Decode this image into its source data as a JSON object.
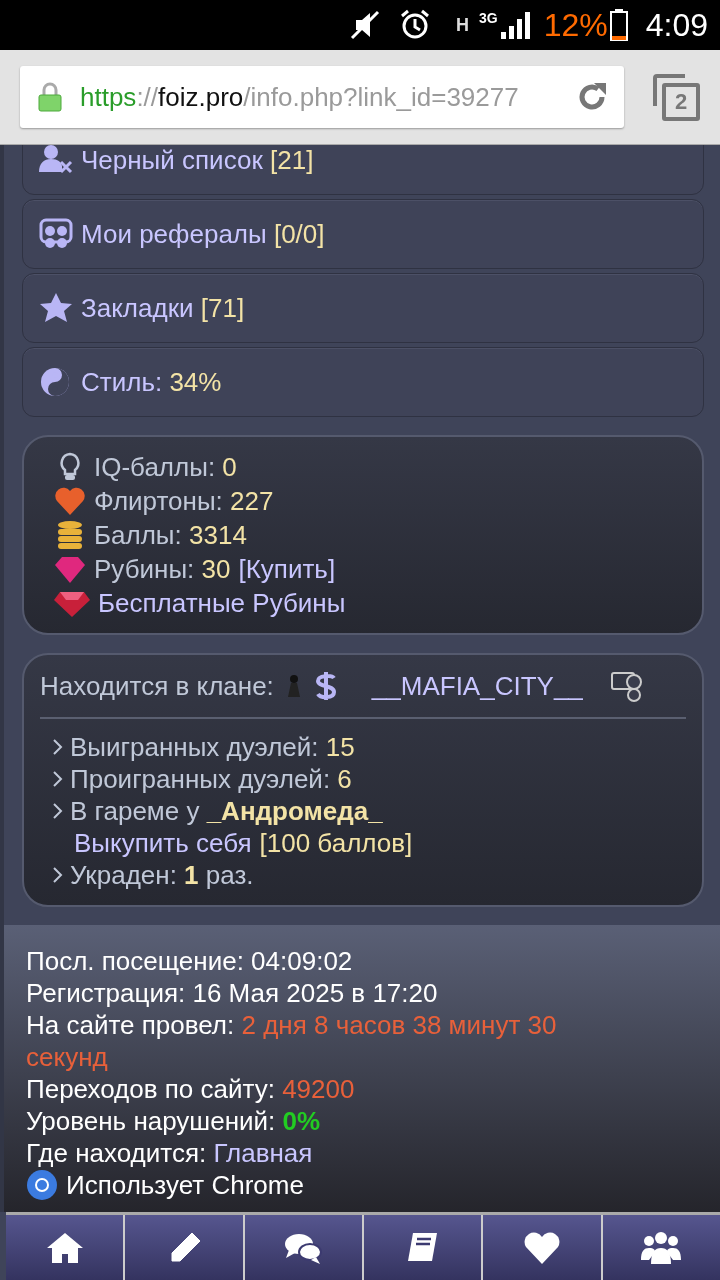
{
  "status_bar": {
    "network_type": "H",
    "signal_label": "3G",
    "battery": "12%",
    "time": "4:09"
  },
  "address_bar": {
    "secure": true,
    "scheme": "https",
    "separator": "://",
    "host": "foiz.pro",
    "path": "/info.php?link_id=39277",
    "tab_count": "2"
  },
  "menu": [
    {
      "kind": "blacklist",
      "label": "Черный список",
      "count": "[21]"
    },
    {
      "kind": "referrals",
      "label": "Мои рефералы",
      "count": "[0/0]"
    },
    {
      "kind": "bookmarks",
      "label": "Закладки",
      "count": "[71]"
    },
    {
      "kind": "style",
      "label": "Стиль:",
      "count": "34%"
    }
  ],
  "stats": [
    {
      "kind": "iq",
      "label": "IQ-баллы:",
      "value": "0"
    },
    {
      "kind": "flirtons",
      "label": "Флиртоны:",
      "value": "227"
    },
    {
      "kind": "points",
      "label": "Баллы:",
      "value": "3314"
    },
    {
      "kind": "rubies",
      "label": "Рубины:",
      "value": "30",
      "link": "[Купить]"
    }
  ],
  "free_rubies": "Бесплатные Рубины",
  "clan": {
    "label": "Находится в клане:",
    "name": "__MAFIA_CITY__"
  },
  "duels": [
    {
      "label": "Выигранных дуэлей:",
      "value": "15"
    },
    {
      "label": "Проигранных дуэлей:",
      "value": "6"
    }
  ],
  "harem": {
    "label": "В гареме у",
    "owner": "_Андромеда_",
    "buyout": "Выкупить себя",
    "cost": "[100 баллов]"
  },
  "stolen": {
    "label": "Украден:",
    "count": "1",
    "suffix": "раз."
  },
  "info": [
    {
      "label": "Посл. посещение: 04:09:02"
    },
    {
      "label": "Регистрация: 16 Мая 2025 в 17:20"
    },
    {
      "label": "На сайте провел:",
      "value": "2 дня 8 часов 38 минут 30 секунд",
      "kind": "orange"
    },
    {
      "label": "Переходов по сайту:",
      "value": "49200",
      "kind": "orange"
    },
    {
      "label": "Уровень нарушений:",
      "value": "0%",
      "kind": "green"
    },
    {
      "label": "Где находится:",
      "value": "Главная",
      "kind": "link"
    }
  ],
  "browser": "Использует Chrome",
  "nav": [
    {
      "kind": "home"
    },
    {
      "kind": "pencil"
    },
    {
      "kind": "chat"
    },
    {
      "kind": "book"
    },
    {
      "kind": "heart"
    },
    {
      "kind": "people"
    }
  ]
}
